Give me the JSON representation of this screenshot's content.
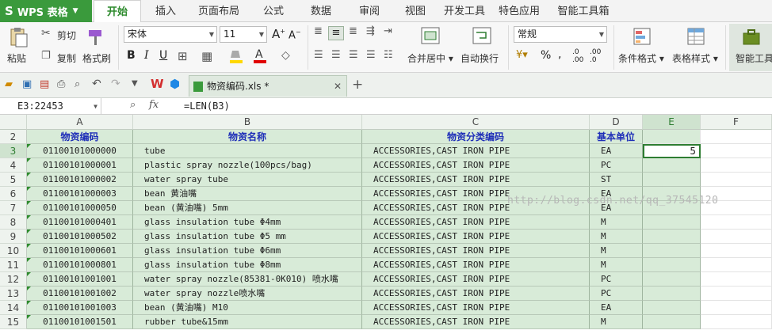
{
  "app": {
    "menu_label": "WPS 表格"
  },
  "menu_tabs": [
    "开始",
    "插入",
    "页面布局",
    "公式",
    "数据",
    "审阅",
    "视图",
    "开发工具",
    "特色应用",
    "智能工具箱"
  ],
  "ribbon": {
    "paste": "粘贴",
    "cut": "剪切",
    "copy": "复制",
    "format_painter": "格式刷",
    "font_name": "宋体",
    "font_size": "11",
    "merge_center": "合并居中",
    "wrap_text": "自动换行",
    "number_format": "常规",
    "conditional_format": "条件格式",
    "table_style": "表格样式",
    "smart_tools": "智能工具",
    "bold": "B",
    "italic": "I",
    "underline": "U",
    "percent": "%"
  },
  "document": {
    "tab_title": "物资编码.xls *"
  },
  "formula_bar": {
    "name_box": "E3:22453",
    "fx": "fx",
    "formula": "=LEN(B3)"
  },
  "sheet": {
    "columns": [
      "A",
      "B",
      "C",
      "D",
      "E",
      "F"
    ],
    "headers": [
      "物资编码",
      "物资名称",
      "物资分类编码",
      "基本单位"
    ],
    "rows": [
      {
        "num": "3",
        "a": "01100101000000",
        "b": "tube",
        "c": "ACCESSORIES,CAST IRON PIPE",
        "d": "EA",
        "e": "5"
      },
      {
        "num": "4",
        "a": "01100101000001",
        "b": "plastic spray nozzle(100pcs/bag)",
        "c": "ACCESSORIES,CAST IRON PIPE",
        "d": "PC",
        "e": ""
      },
      {
        "num": "5",
        "a": "01100101000002",
        "b": "water spray tube",
        "c": "ACCESSORIES,CAST IRON PIPE",
        "d": "ST",
        "e": ""
      },
      {
        "num": "6",
        "a": "01100101000003",
        "b": "bean 黄油嘴",
        "c": "ACCESSORIES,CAST IRON PIPE",
        "d": "EA",
        "e": ""
      },
      {
        "num": "7",
        "a": "01100101000050",
        "b": "bean (黄油嘴) 5mm",
        "c": "ACCESSORIES,CAST IRON PIPE",
        "d": "EA",
        "e": ""
      },
      {
        "num": "8",
        "a": "01100101000401",
        "b": "glass insulation tube Φ4mm",
        "c": "ACCESSORIES,CAST IRON PIPE",
        "d": "M",
        "e": ""
      },
      {
        "num": "9",
        "a": "01100101000502",
        "b": "glass insulation tube Φ5 mm",
        "c": "ACCESSORIES,CAST IRON PIPE",
        "d": "M",
        "e": ""
      },
      {
        "num": "10",
        "a": "01100101000601",
        "b": "glass insulation tube Φ6mm",
        "c": "ACCESSORIES,CAST IRON PIPE",
        "d": "M",
        "e": ""
      },
      {
        "num": "11",
        "a": "01100101000801",
        "b": "glass insulation tube Φ8mm",
        "c": "ACCESSORIES,CAST IRON PIPE",
        "d": "M",
        "e": ""
      },
      {
        "num": "12",
        "a": "01100101001001",
        "b": "water spray nozzle(85381-0K010) 喷水嘴",
        "c": "ACCESSORIES,CAST IRON PIPE",
        "d": "PC",
        "e": ""
      },
      {
        "num": "13",
        "a": "01100101001002",
        "b": "water spray nozzle喷水嘴",
        "c": "ACCESSORIES,CAST IRON PIPE",
        "d": "PC",
        "e": ""
      },
      {
        "num": "14",
        "a": "01100101001003",
        "b": "bean (黄油嘴) M10",
        "c": "ACCESSORIES,CAST IRON PIPE",
        "d": "EA",
        "e": ""
      },
      {
        "num": "15",
        "a": "01100101001501",
        "b": "rubber tube&15mm",
        "c": "ACCESSORIES,CAST IRON PIPE",
        "d": "M",
        "e": ""
      }
    ],
    "watermark": "http://blog.csdn.net/qq_37545120",
    "colors": {
      "cell_fill": "#d8ebd8",
      "header_text": "#1f2fb8",
      "active_border": "#2e7d32",
      "brand_green": "#3a9a3c"
    }
  }
}
